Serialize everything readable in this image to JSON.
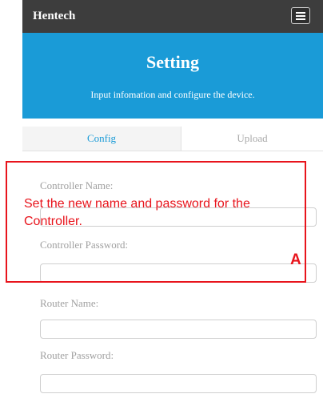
{
  "navbar": {
    "brand": "Hentech",
    "menu_icon": "hamburger-menu-icon"
  },
  "header": {
    "title": "Setting",
    "subtitle": "Input infomation and configure the device."
  },
  "tabs": [
    {
      "label": "Config",
      "active": true
    },
    {
      "label": "Upload",
      "active": false
    }
  ],
  "form": {
    "controller_name_label": "Controller Name:",
    "controller_password_label": "Controller Password:",
    "router_name_label": "Router Name:",
    "router_password_label": "Router Password:",
    "controller_name_value": "",
    "controller_password_value": "",
    "router_name_value": "",
    "router_password_value": ""
  },
  "annotation": {
    "text": "Set the new name and password for the Controller.",
    "marker": "A",
    "color": "#e8141c"
  },
  "colors": {
    "accent": "#1a9bd7",
    "navbar": "#3d3d3d"
  }
}
